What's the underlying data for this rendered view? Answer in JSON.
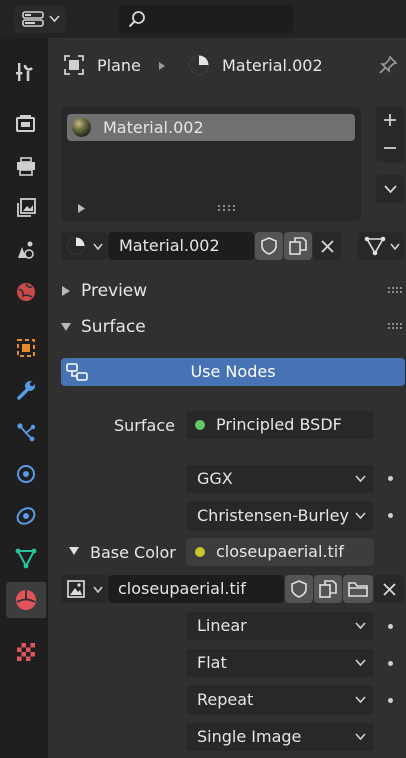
{
  "header": {
    "editor_type_icon": "properties-editor-icon",
    "search_icon": "search-icon"
  },
  "breadcrumb": {
    "object": "Plane",
    "material": "Material.002"
  },
  "material_slots": {
    "items": [
      "Material.002"
    ],
    "add_icon": "plus-icon",
    "remove_icon": "minus-icon",
    "specials_icon": "chevron-down-icon"
  },
  "material_datablock": {
    "name": "Material.002"
  },
  "panels": {
    "preview": "Preview",
    "surface": "Surface"
  },
  "surface": {
    "use_nodes_label": "Use Nodes",
    "surface_label": "Surface",
    "surface_shader": "Principled BSDF",
    "distribution": "GGX",
    "subsurface_method": "Christensen-Burley",
    "base_color_label": "Base Color",
    "base_color_texture": "closeupaerial.tif",
    "image_name": "closeupaerial.tif",
    "interpolation": "Linear",
    "projection": "Flat",
    "extension": "Repeat",
    "source": "Single Image"
  },
  "colors": {
    "accent_blue": "#4772b3",
    "shader_green": "#63c763",
    "texture_yellow": "#c7c729",
    "material_active_red": "#e0545c"
  }
}
